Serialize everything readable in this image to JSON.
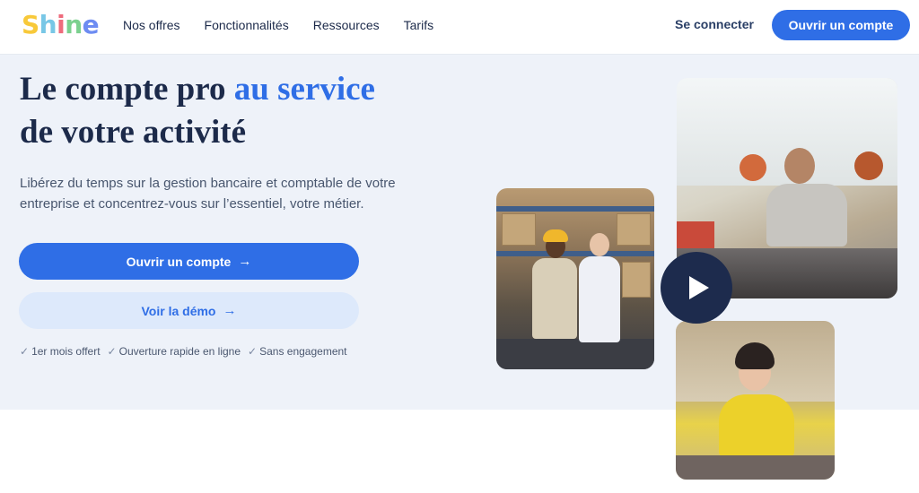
{
  "brand": {
    "logo_letters": [
      "S",
      "h",
      "i",
      "n",
      "e"
    ],
    "colors": {
      "primary": "#2f6ee6",
      "dark": "#1c2a4a",
      "hero_bg": "#eef2f9",
      "secondary_bg": "#dde9fb"
    }
  },
  "nav": {
    "links": [
      "Nos offres",
      "Fonctionnalités",
      "Ressources",
      "Tarifs"
    ],
    "login_label": "Se connecter",
    "cta_label": "Ouvrir un compte"
  },
  "hero": {
    "headline_part1": "Le compte pro",
    "headline_accent": "au service",
    "headline_part2": "de votre activité",
    "subtitle": "Libérez du temps sur la gestion bancaire et comptable de votre entreprise et concentrez-vous sur l’essentiel, votre métier.",
    "primary_button": "Ouvrir un compte",
    "secondary_button": "Voir la démo",
    "arrow_icon": "→",
    "perks": [
      "1er mois offert",
      "Ouverture rapide en ligne",
      "Sans engagement"
    ],
    "check_icon": "✓"
  },
  "media": {
    "photos": [
      "warehouse-photo",
      "office-photo",
      "home-office-photo"
    ],
    "play_icon": "play-icon"
  }
}
